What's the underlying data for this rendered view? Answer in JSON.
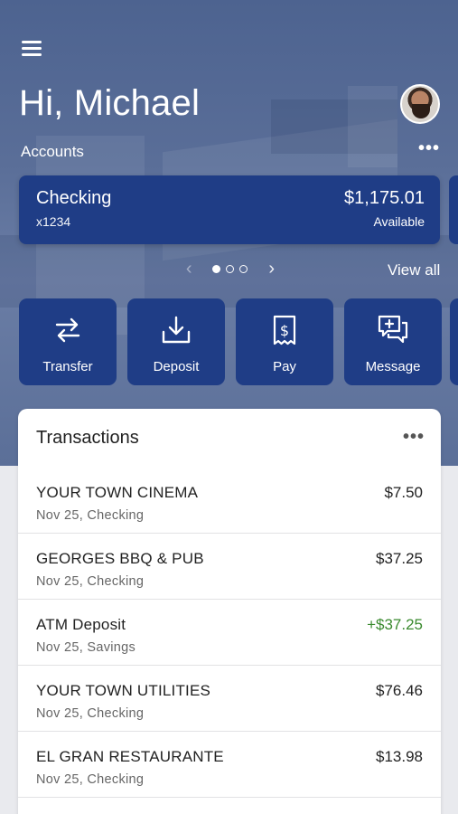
{
  "header": {
    "greeting": "Hi, Michael",
    "accounts_label": "Accounts"
  },
  "account_card": {
    "name": "Checking",
    "number": "x1234",
    "balance": "$1,175.01",
    "balance_label": "Available"
  },
  "pager": {
    "prev_icon": "‹",
    "next_icon": "›",
    "view_all": "View all"
  },
  "actions": [
    {
      "label": "Transfer",
      "icon": "transfer-icon"
    },
    {
      "label": "Deposit",
      "icon": "deposit-icon"
    },
    {
      "label": "Pay",
      "icon": "pay-icon"
    },
    {
      "label": "Message",
      "icon": "message-icon"
    }
  ],
  "transactions": {
    "title": "Transactions",
    "items": [
      {
        "merchant": "YOUR TOWN CINEMA",
        "meta": "Nov 25, Checking",
        "amount": "$7.50"
      },
      {
        "merchant": "GEORGES BBQ & PUB",
        "meta": "Nov 25, Checking",
        "amount": "$37.25"
      },
      {
        "merchant": "ATM Deposit",
        "meta": "Nov 25, Savings",
        "amount": "+$37.25"
      },
      {
        "merchant": "YOUR TOWN UTILITIES",
        "meta": "Nov 25, Checking",
        "amount": "$76.46"
      },
      {
        "merchant": "EL GRAN RESTAURANTE",
        "meta": "Nov 25, Checking",
        "amount": "$13.98"
      }
    ]
  },
  "colors": {
    "card": "#1f3d86",
    "hero": "#5a6e98",
    "positive": "#3a8a2e"
  }
}
